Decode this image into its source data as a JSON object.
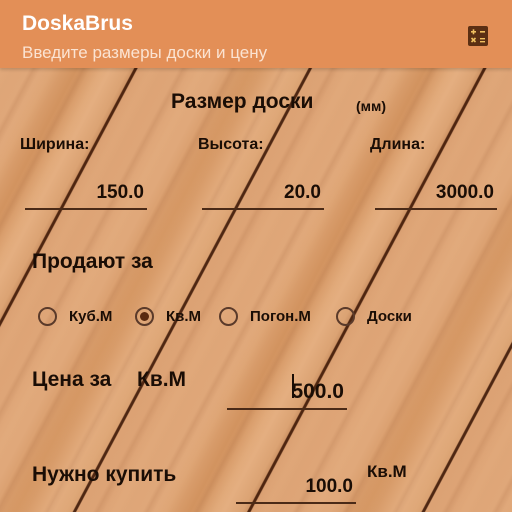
{
  "app": {
    "title": "DoskaBrus",
    "subtitle": "Введите размеры доски и цену"
  },
  "toolbar": {
    "calculator_icon": "calculator-icon"
  },
  "board_size": {
    "title": "Размер доски",
    "unit": "(мм)",
    "width_label": "Ширина:",
    "height_label": "Высота:",
    "length_label": "Длина:",
    "width_value": "150.0",
    "height_value": "20.0",
    "length_value": "3000.0"
  },
  "sold_by": {
    "title": "Продают за",
    "options": [
      {
        "label": "Куб.М",
        "checked": false
      },
      {
        "label": "Кв.М",
        "checked": true
      },
      {
        "label": "Погон.М",
        "checked": false
      },
      {
        "label": "Доски",
        "checked": false
      }
    ]
  },
  "price": {
    "label": "Цена за",
    "unit": "Кв.М",
    "value": "500.0"
  },
  "need_to_buy": {
    "label": "Нужно купить",
    "value": "100.0",
    "unit": "Кв.М"
  },
  "colors": {
    "appbar": "#e38f57",
    "text": "#1a0d05",
    "underline": "#4a2a17"
  }
}
